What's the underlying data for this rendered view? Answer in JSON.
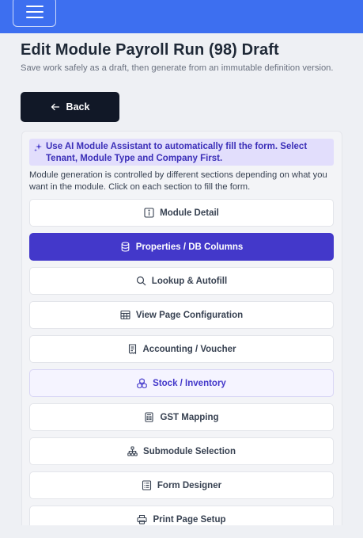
{
  "header": {
    "menu_icon": "hamburger-menu-icon"
  },
  "page": {
    "title": "Edit Module Payroll Run (98) Draft",
    "subtitle": "Save work safely as a draft, then generate from an immutable definition version."
  },
  "back_button": {
    "label": "Back",
    "icon": "arrow-left-icon"
  },
  "ai_banner": {
    "icon": "sparkles-icon",
    "text": "Use AI Module Assistant to automatically fill the form. Select Tenant, Module Type and Company First."
  },
  "info_text": "Module generation is controlled by different sections depending on what you want in the module. Click on each section to fill the form.",
  "sections": [
    {
      "label": "Module Detail",
      "icon": "info-icon"
    },
    {
      "label": "Properties / DB Columns",
      "icon": "database-icon"
    },
    {
      "label": "Lookup & Autofill",
      "icon": "search-icon"
    },
    {
      "label": "View Page Configuration",
      "icon": "table-icon"
    },
    {
      "label": "Accounting / Voucher",
      "icon": "receipt-icon"
    },
    {
      "label": "Stock / Inventory",
      "icon": "boxes-icon"
    },
    {
      "label": "GST Mapping",
      "icon": "calculator-icon"
    },
    {
      "label": "Submodule Selection",
      "icon": "hierarchy-icon"
    },
    {
      "label": "Form Designer",
      "icon": "form-icon"
    },
    {
      "label": "Print Page Setup",
      "icon": "printer-icon"
    }
  ],
  "colors": {
    "topbar": "#3d6ff0",
    "active_section": "#4338ca",
    "back_button": "#111827",
    "ai_banner_bg": "#e2defc"
  }
}
